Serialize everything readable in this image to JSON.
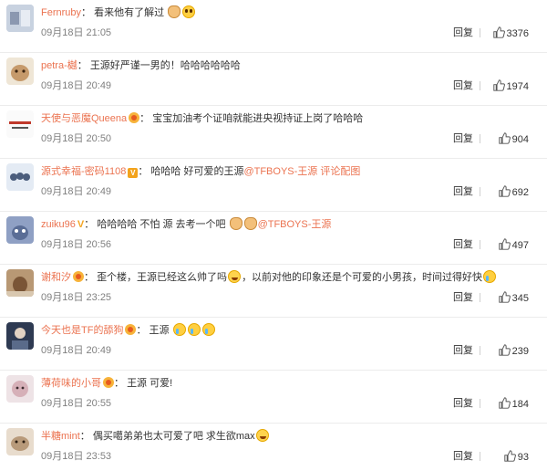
{
  "comments": [
    {
      "user": "Fernruby",
      "text": "看来他有了解过",
      "emoji": "cat,cat",
      "date": "09月18日 21:05",
      "reply": "回复",
      "likes": "3376",
      "avatar_color": "#b7c3d6"
    },
    {
      "user": "petra-樾",
      "text": "王源好严谨一男的！哈哈哈哈哈哈",
      "emoji": "",
      "date": "09月18日 20:49",
      "reply": "回复",
      "likes": "1974",
      "avatar_color": "#d8c7b0"
    },
    {
      "user": "天使与恶魔Queena",
      "text": "宝宝加油考个证咱就能进央视持证上岗了哈哈哈",
      "emoji": "",
      "date": "09月18日 20:50",
      "reply": "回复",
      "likes": "904",
      "avatar_color": "#f4f4f4"
    },
    {
      "user": "源式幸福-密码1108",
      "text": "哈哈哈 好可爱的王源",
      "mention": "@TFBOYS-王源",
      "text_after": "评论配图",
      "date": "09月18日 20:49",
      "reply": "回复",
      "likes": "692",
      "avatar_color": "#cfd9e8"
    },
    {
      "user": "zuiku96",
      "text": "哈哈哈哈 不怕 源 去考一个吧",
      "mention": "@TFBOYS-王源",
      "date": "09月18日 20:56",
      "reply": "回复",
      "likes": "497",
      "avatar_color": "#6e7ea8"
    },
    {
      "user": "谢和汐",
      "text": "歪个楼，王源已经这么帅了吗",
      "text_after": "，以前对他的印象还是个可爱的小男孩，时间过得好快",
      "date": "09月18日 23:25",
      "reply": "回复",
      "likes": "345",
      "avatar_color": "#9a7b5a"
    },
    {
      "user": "今天也是TF的舔狗",
      "text": "王源",
      "date": "09月18日 20:49",
      "reply": "回复",
      "likes": "239",
      "avatar_color": "#3c4a63"
    },
    {
      "user": "薄荷味的小哥",
      "text": "王源 可爱!",
      "date": "09月18日 20:55",
      "reply": "回复",
      "likes": "184",
      "avatar_color": "#d9c2c8"
    },
    {
      "user": "半糖mint",
      "text": "偶买噶弟弟也太可爱了吧 求生欲max",
      "date": "09月18日 23:53",
      "reply": "回复",
      "likes": "93",
      "avatar_color": "#c9b29a"
    }
  ],
  "colors": {
    "username": "#eb7350",
    "meta": "#808080",
    "text": "#333333"
  },
  "icons": {
    "like": "thumbs-up-icon",
    "badge": "vip-badge-icon",
    "emoji": "emoji-icon"
  }
}
